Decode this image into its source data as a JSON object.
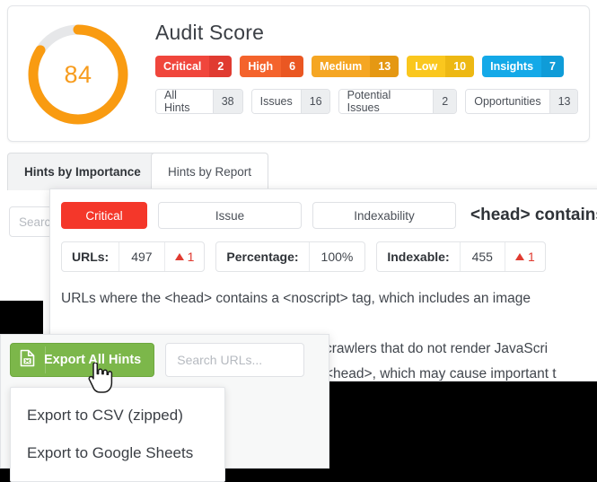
{
  "audit": {
    "title": "Audit Score",
    "score": "84",
    "score_percent": 84,
    "severities": [
      {
        "label": "Critical",
        "count": "2",
        "color": "#f0463c"
      },
      {
        "label": "High",
        "count": "6",
        "color": "#f4632c"
      },
      {
        "label": "Medium",
        "count": "13",
        "color": "#f5a623"
      },
      {
        "label": "Low",
        "count": "10",
        "color": "#fac71e"
      },
      {
        "label": "Insights",
        "count": "7",
        "color": "#14a9e8"
      }
    ],
    "chips": [
      {
        "label": "All Hints",
        "count": "38"
      },
      {
        "label": "Issues",
        "count": "16"
      },
      {
        "label": "Potential Issues",
        "count": "2"
      },
      {
        "label": "Opportunities",
        "count": "13"
      }
    ]
  },
  "tabs": {
    "active": "Hints by Importance",
    "inactive": "Hints by Report"
  },
  "under_search": {
    "placeholder": "Search..."
  },
  "detail": {
    "severity_label": "Critical",
    "type_label": "Issue",
    "category_label": "Indexability",
    "title": "<head> contains ",
    "metrics": [
      {
        "key": "URLs:",
        "value": "497",
        "delta": "1"
      },
      {
        "key": "Percentage:",
        "value": "100%",
        "delta": ""
      },
      {
        "key": "Indexable:",
        "value": "455",
        "delta": "1"
      }
    ],
    "description_line1": "URLs where the <head> contains a <noscript> tag, which includes an image",
    "description_line2": "",
    "description_line3": "crawlers that do not render JavaScri",
    "description_line4": "<head>, which may cause important t"
  },
  "export": {
    "button_label": "Export All Hints",
    "button_icon": "file-export-icon",
    "search_placeholder": "Search URLs...",
    "menu": [
      {
        "label": "Export to CSV (zipped)"
      },
      {
        "label": "Export to Google Sheets"
      }
    ]
  },
  "colors": {
    "score_accent": "#f79c1e",
    "critical": "#f4372a",
    "export_green": "#7cb74a",
    "delta_red": "#e03b31"
  }
}
